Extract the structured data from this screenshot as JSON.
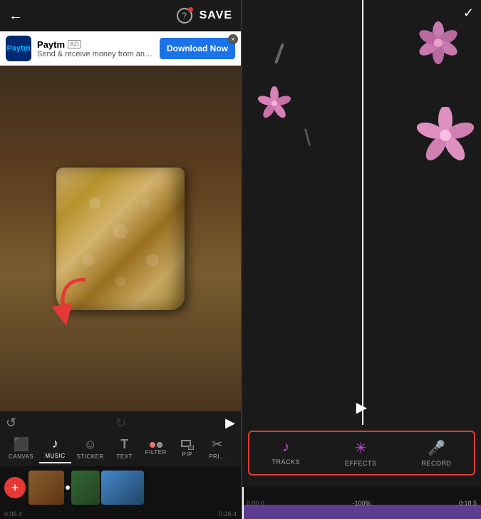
{
  "header": {
    "back_label": "←",
    "help_label": "?",
    "save_label": "SAVE"
  },
  "ad": {
    "logo_text": "Paytm",
    "title": "Paytm",
    "badge": "AD",
    "subtitle": "Send & receive money from any phone ...",
    "cta": "Download Now",
    "close": "×"
  },
  "toolbar": {
    "undo": "↺",
    "play": "▶",
    "tools": [
      {
        "id": "canvas",
        "label": "CANVAS",
        "icon": "⬜"
      },
      {
        "id": "music",
        "label": "MUSIC",
        "icon": "♪"
      },
      {
        "id": "sticker",
        "label": "STICKER",
        "icon": "☺"
      },
      {
        "id": "text",
        "label": "TEXT",
        "icon": "T"
      },
      {
        "id": "filter",
        "label": "FILTER",
        "icon": "⬤"
      },
      {
        "id": "pip",
        "label": "PIP",
        "icon": "⬛"
      }
    ]
  },
  "timeline": {
    "add_icon": "+",
    "timestamps": [
      "0:06.4",
      "0:26.4"
    ]
  },
  "right_panel": {
    "check_icon": "✓",
    "play_icon": "▶",
    "tools": [
      {
        "id": "tracks",
        "label": "TRACKS"
      },
      {
        "id": "effects",
        "label": "EFFECTS"
      },
      {
        "id": "record",
        "label": "RECORD"
      }
    ],
    "timestamps": [
      "0:00.0",
      "0:18.5"
    ],
    "zoom": "100%",
    "cursor_time": "0:00.0"
  }
}
